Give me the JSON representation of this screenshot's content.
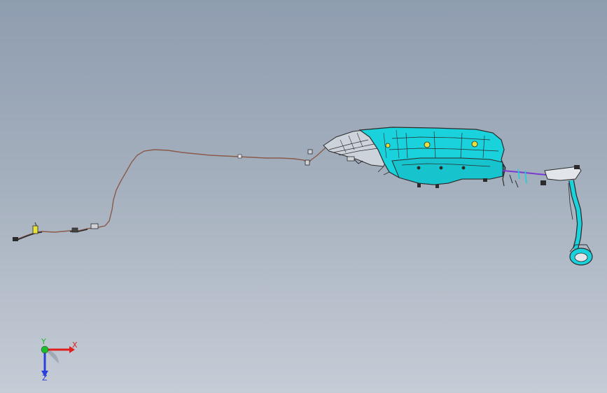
{
  "viewport": {
    "background_top": "#8f9db0",
    "background_bottom": "#c5ccd6"
  },
  "model": {
    "tank_color": "#19d2dc",
    "edge_color": "#2b2b2b",
    "hose_color": "#d0d0d0",
    "line_color": "#8a5a4a",
    "vent_color": "#7a3ad0",
    "marker_color": "#e6e23a"
  },
  "triad": {
    "x_label": "X",
    "y_label": "Y",
    "z_label": "Z",
    "x_color": "#e01f1f",
    "y_color": "#1bbd2a",
    "z_color": "#2a3fd8"
  }
}
